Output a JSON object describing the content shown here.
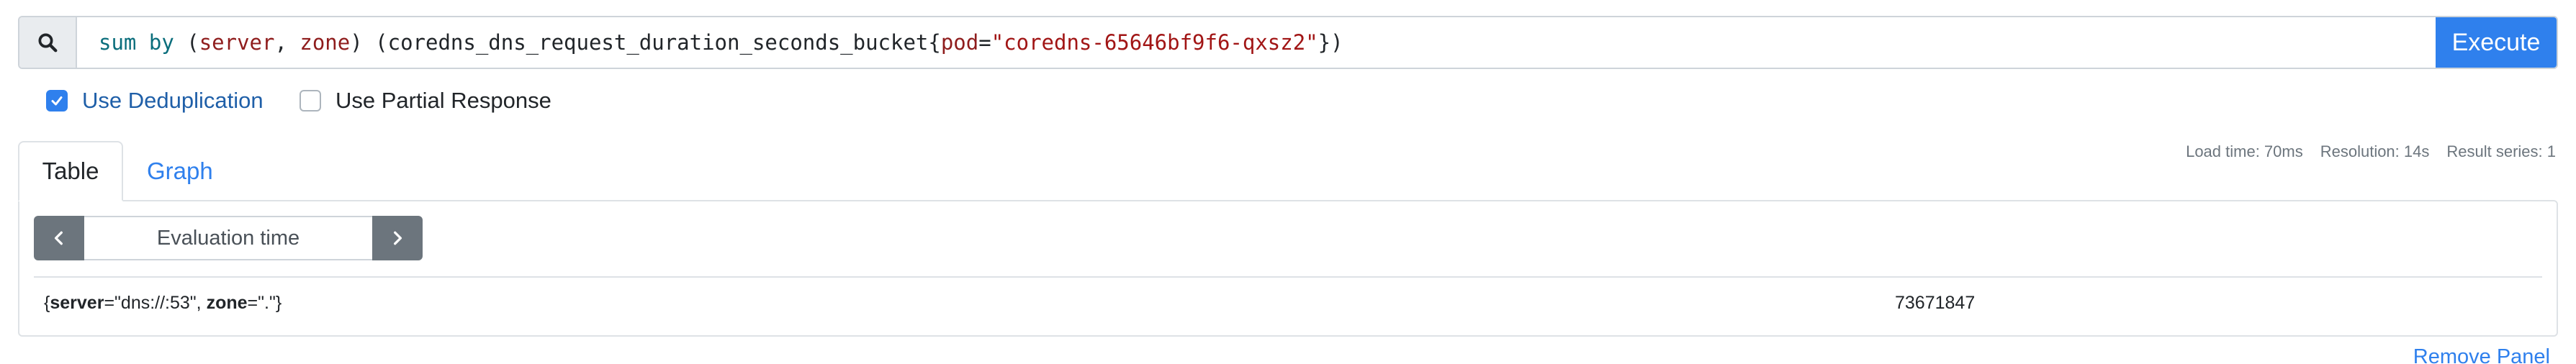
{
  "query": {
    "expression_tokens": [
      {
        "text": "sum",
        "type": "fn"
      },
      {
        "text": " ",
        "type": "pun"
      },
      {
        "text": "by",
        "type": "kw"
      },
      {
        "text": " (",
        "type": "pun"
      },
      {
        "text": "server",
        "type": "lbl"
      },
      {
        "text": ", ",
        "type": "pun"
      },
      {
        "text": "zone",
        "type": "lbl"
      },
      {
        "text": ") (coredns_dns_request_duration_seconds_bucket{",
        "type": "pun"
      },
      {
        "text": "pod",
        "type": "lbl"
      },
      {
        "text": "=",
        "type": "pun"
      },
      {
        "text": "\"coredns-65646bf9f6-qxsz2\"",
        "type": "str"
      },
      {
        "text": "})",
        "type": "pun"
      }
    ],
    "search_icon": "search-icon",
    "execute_label": "Execute"
  },
  "options": {
    "dedup": {
      "label": "Use Deduplication",
      "checked": true
    },
    "partial": {
      "label": "Use Partial Response",
      "checked": false
    }
  },
  "tabs": {
    "table": "Table",
    "graph": "Graph",
    "active": "table"
  },
  "stats": {
    "load_time": "Load time: 70ms",
    "resolution": "Resolution: 14s",
    "result_series": "Result series: 1"
  },
  "panel": {
    "eval_placeholder": "Evaluation time",
    "prev_icon": "chevron-left-icon",
    "next_icon": "chevron-right-icon",
    "result": {
      "open_brace": "{",
      "label1_key": "server",
      "label1_eq": "=\"dns://:53\", ",
      "label2_key": "zone",
      "label2_eq": "=\".\"}",
      "value": "73671847"
    },
    "remove_label": "Remove Panel"
  },
  "colors": {
    "accent": "#2f80ed",
    "secondary_button": "#6c757d",
    "border": "#dee2e6"
  }
}
